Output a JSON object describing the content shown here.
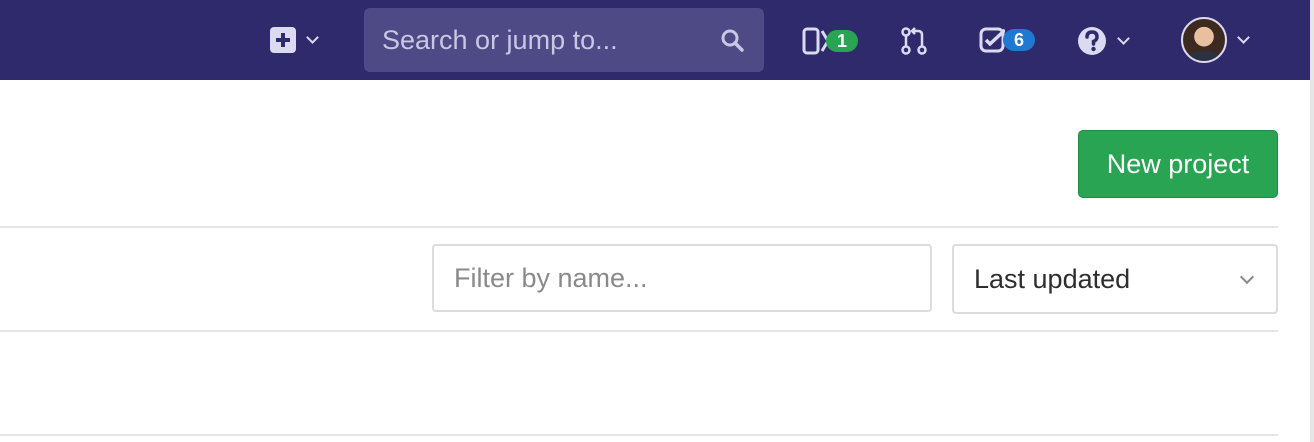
{
  "navbar": {
    "search": {
      "placeholder": "Search or jump to..."
    },
    "issues_badge": "1",
    "todos_badge": "6",
    "colors": {
      "background": "#2f2a6b",
      "search_bg": "#4d4a86",
      "issues_badge": "#28a452",
      "todos_badge": "#1f78d1"
    }
  },
  "main": {
    "new_project_label": "New project",
    "filter": {
      "placeholder": "Filter by name..."
    },
    "sort": {
      "selected": "Last updated"
    },
    "colors": {
      "new_project_button": "#28a452"
    }
  }
}
